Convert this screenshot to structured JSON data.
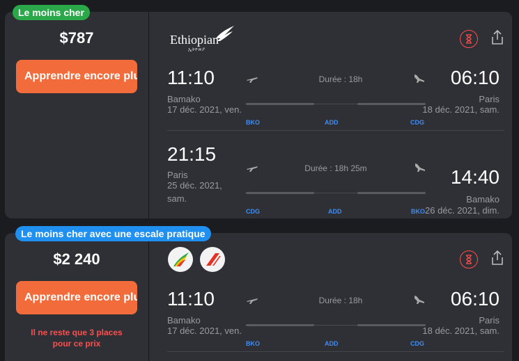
{
  "colors": {
    "cheapest_badge": "#2aa84a",
    "practical_badge": "#1f8ff0",
    "cta": "#f26b3a",
    "code": "#3f8cf2",
    "warning": "#ff4d4d"
  },
  "card1": {
    "badge": "Le moins cher",
    "price": "$787",
    "cta_label": "Apprendre encore plus",
    "airline_logo": {
      "text": "Ethiopian",
      "sub": "ኢትዮጵያ"
    },
    "segments": [
      {
        "dep_time": "11:10",
        "dep_city": "Bamako",
        "dep_date": "17 déc. 2021, ven.",
        "arr_time": "06:10",
        "arr_city": "Paris",
        "arr_date": "18 déc. 2021, sam.",
        "duration": "Durée : 18h",
        "dep_code": "BKO",
        "stop_code": "ADD",
        "arr_code": "CDG"
      },
      {
        "dep_time": "21:15",
        "dep_city": "Paris",
        "dep_date_1": "25 déc. 2021,",
        "dep_date_2": "sam.",
        "arr_time": "14:40",
        "arr_city": "Bamako",
        "arr_date": "26 déc. 2021, dim.",
        "duration": "Durée : 18h 25m",
        "dep_code": "CDG",
        "stop_code": "ADD",
        "arr_code": "BKO"
      }
    ]
  },
  "card2": {
    "badge": "Le moins cher avec une escale pratique",
    "price": "$2 240",
    "cta_label": "Apprendre encore plus",
    "warning_1": "Il ne reste que 3 places",
    "warning_2": "pour ce prix",
    "segments": [
      {
        "dep_time": "11:10",
        "dep_city": "Bamako",
        "dep_date": "17 déc. 2021, ven.",
        "arr_time": "06:10",
        "arr_city": "Paris",
        "arr_date": "18 déc. 2021, sam.",
        "duration": "Durée : 18h",
        "dep_code": "BKO",
        "stop_code": "ADD",
        "arr_code": "CDG"
      }
    ]
  }
}
